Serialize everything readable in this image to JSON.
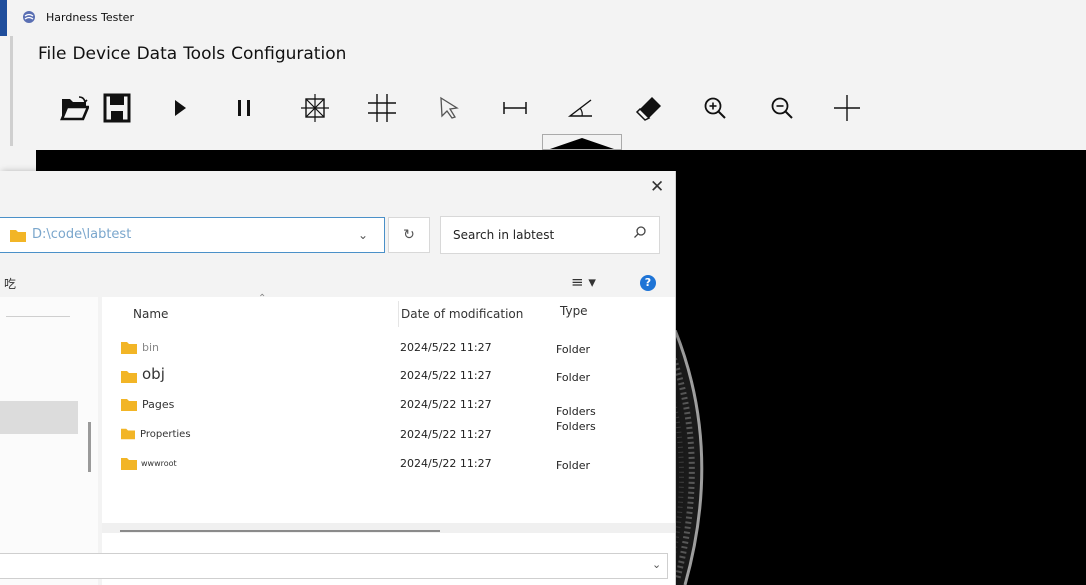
{
  "window": {
    "title": "Hardness Tester"
  },
  "menu": [
    "File",
    "Device",
    "Data",
    "Tools",
    "Configuration"
  ],
  "toolbar": {
    "tools": [
      {
        "name": "open-folder-icon"
      },
      {
        "name": "save-icon"
      },
      {
        "name": "play-icon"
      },
      {
        "name": "pause-icon"
      },
      {
        "name": "auto-measure-icon"
      },
      {
        "name": "grid-icon"
      },
      {
        "name": "pointer-icon"
      },
      {
        "name": "distance-icon"
      },
      {
        "name": "angle-icon"
      },
      {
        "name": "eraser-icon"
      },
      {
        "name": "zoom-in-icon"
      },
      {
        "name": "zoom-out-icon"
      },
      {
        "name": "crosshair-icon"
      }
    ]
  },
  "dialog": {
    "path": "D:\\code\\labtest",
    "search_placeholder": "Search in labtest",
    "left_glyph": "吃",
    "close_glyph": "✕",
    "refresh_glyph": "↻",
    "help_glyph": "?",
    "columns": {
      "name": "Name",
      "date": "Date of modification",
      "type": "Type"
    },
    "files": [
      {
        "name": "bin",
        "date": "2024/5/22 11:27",
        "type": "Folder"
      },
      {
        "name": "obj",
        "date": "2024/5/22 11:27",
        "type": "Folder"
      },
      {
        "name": "Pages",
        "date": "2024/5/22 11:27",
        "type": "Folders"
      },
      {
        "name": "Properties",
        "date": "2024/5/22 11:27",
        "type": "Folders"
      },
      {
        "name": "wwwroot",
        "date": "2024/5/22 11:27",
        "type": "Folder"
      }
    ]
  },
  "colors": {
    "accent": "#1f4e9c",
    "folder": "#f2b526",
    "viewer_bg": "#000000"
  }
}
